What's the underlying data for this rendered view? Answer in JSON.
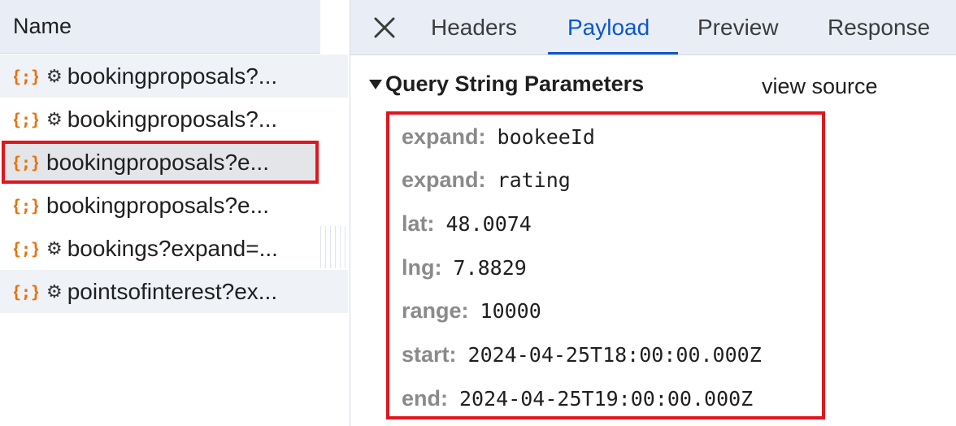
{
  "network_list": {
    "header": "Name",
    "requests": [
      {
        "label": "bookingproposals?...",
        "has_gear": true,
        "shaded": true,
        "selected": false
      },
      {
        "label": "bookingproposals?...",
        "has_gear": true,
        "shaded": false,
        "selected": false
      },
      {
        "label": "bookingproposals?e...",
        "has_gear": false,
        "shaded": false,
        "selected": true
      },
      {
        "label": "bookingproposals?e...",
        "has_gear": false,
        "shaded": false,
        "selected": false
      },
      {
        "label": "bookings?expand=...",
        "has_gear": true,
        "shaded": false,
        "selected": false
      },
      {
        "label": "pointsofinterest?ex...",
        "has_gear": true,
        "shaded": true,
        "selected": false
      }
    ],
    "icon": "json-braces-icon"
  },
  "tabs": [
    {
      "label": "Headers",
      "active": false
    },
    {
      "label": "Payload",
      "active": true
    },
    {
      "label": "Preview",
      "active": false
    },
    {
      "label": "Response",
      "active": false
    }
  ],
  "payload": {
    "section_title": "Query String Parameters",
    "view_source": "view source",
    "params": [
      {
        "key": "expand:",
        "value": "bookeeId"
      },
      {
        "key": "expand:",
        "value": "rating"
      },
      {
        "key": "lat:",
        "value": "48.0074"
      },
      {
        "key": "lng:",
        "value": "7.8829"
      },
      {
        "key": "range:",
        "value": "10000"
      },
      {
        "key": "start:",
        "value": "2024-04-25T18:00:00.000Z"
      },
      {
        "key": "end:",
        "value": "2024-04-25T19:00:00.000Z"
      }
    ]
  },
  "colors": {
    "accent": "#0b57d0",
    "highlight_border": "#e0161d",
    "json_icon": "#e8710a",
    "header_bg": "#e9eef6"
  }
}
